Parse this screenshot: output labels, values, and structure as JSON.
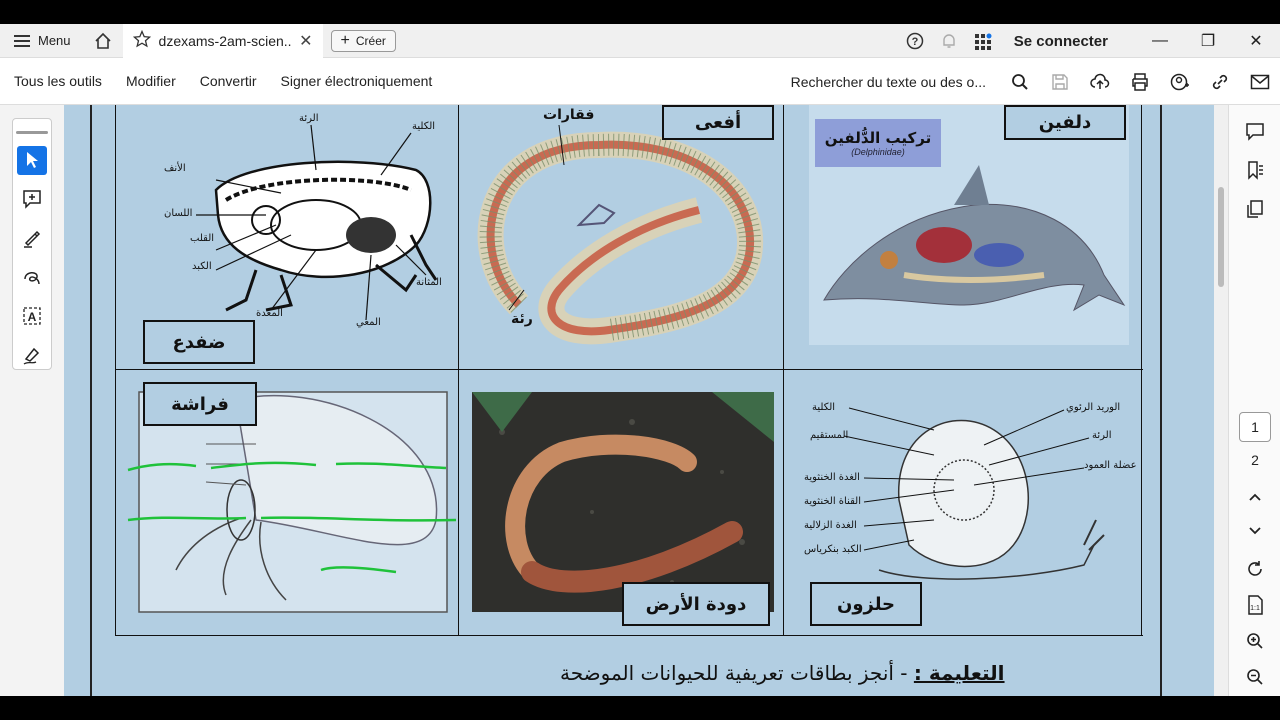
{
  "tabbar": {
    "menu_label": "Menu",
    "tab_title": "dzexams-2am-scien...",
    "create_label": "Créer",
    "signin_label": "Se connecter"
  },
  "toolbar": {
    "all_tools": "Tous les outils",
    "edit": "Modifier",
    "convert": "Convertir",
    "sign": "Signer électroniquement",
    "search_text": "Rechercher du texte ou des o..."
  },
  "pages": {
    "current": "1",
    "next": "2"
  },
  "document": {
    "animals": {
      "frog": "ضفدع",
      "viper": "أفعى",
      "vertebrae": "فقارات",
      "lung_viper": "رئة",
      "dolphin": "دلفين",
      "dolphin_structure": "تركيب الدُّلفين",
      "dolphin_latin": "(Delphinidae)",
      "butterfly": "فراشة",
      "earthworm": "دودة الأرض",
      "snail": "حلزون"
    },
    "frog_labels": {
      "kidney": "الكلية",
      "lung": "الرئة",
      "nose": "الأنف",
      "tongue": "اللسان",
      "heart": "القلب",
      "liver": "الكبد",
      "stomach": "المعدة",
      "intestine": "المعي",
      "bladder": "المثانة"
    },
    "snail_labels": {
      "kidney": "الكلية",
      "rectum": "المستقيم",
      "hermaphrodite_gland": "الغدة الخنثوية",
      "hermaphrodite_duct": "القناة الخنثوية",
      "albumen_gland": "الغدة الزلالية",
      "hepatopancreas": "الكبد بنكرياس",
      "pulmonary_vein": "الوريد الرئوي",
      "lung": "الرئة",
      "columella_muscle": "عضلة العمود"
    },
    "instruction_label": "التعليمة :",
    "instruction_text": "أنجز بطاقات تعريفية للحيوانات الموضحة"
  },
  "colors": {
    "accent": "#1473e6",
    "paper": "#b2cee2",
    "ink_green": "#1fc23a"
  }
}
